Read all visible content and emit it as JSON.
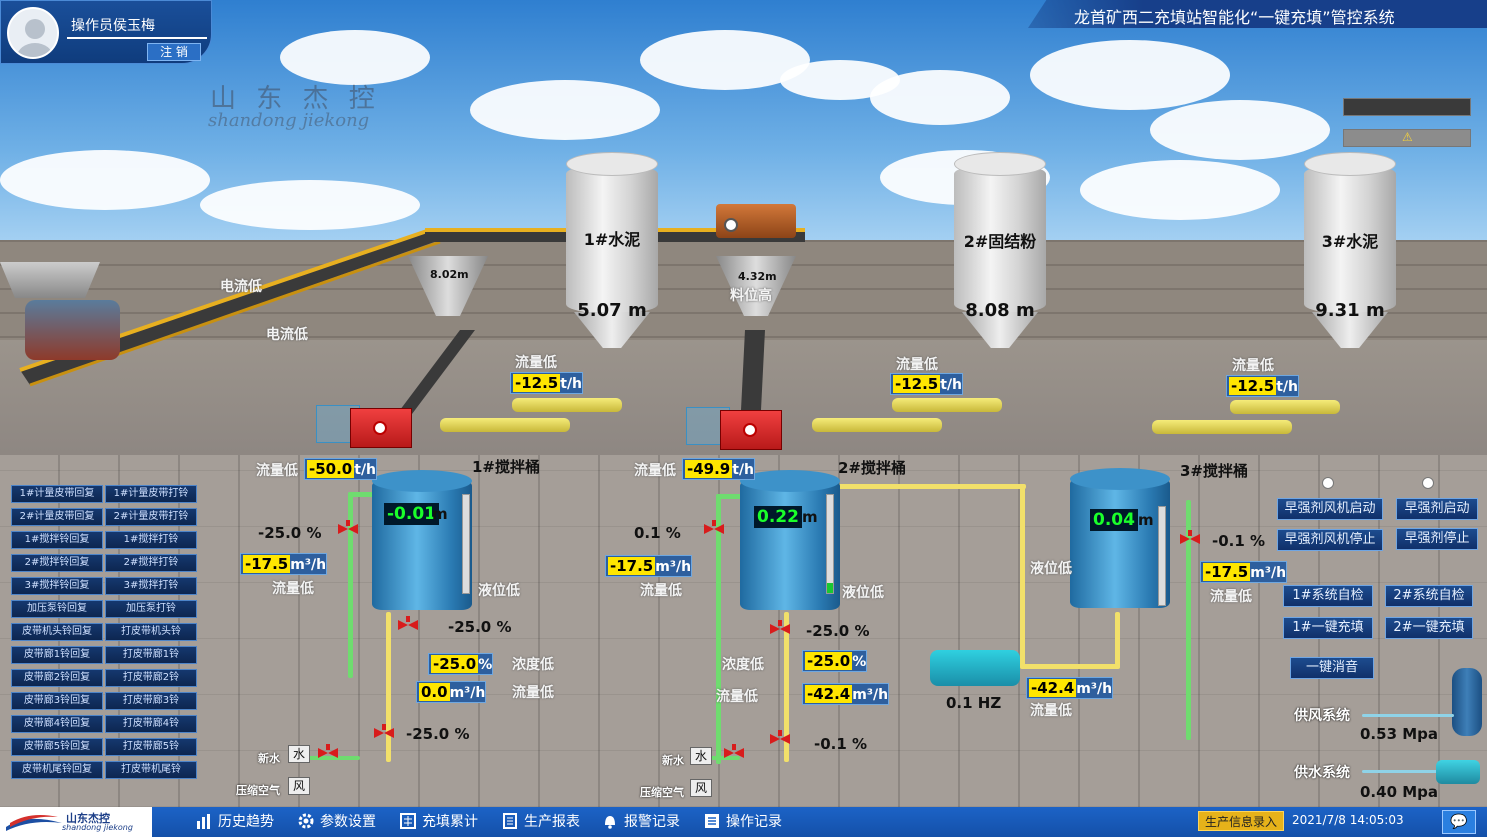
{
  "header": {
    "operator": "操作员侯玉梅",
    "logout": "注 销",
    "system_title": "龙首矿西二充填站智能化“一键充填”管控系统",
    "watermark_cn": "山 东 杰 控",
    "watermark_en": "shandong jiekong"
  },
  "silos": [
    {
      "name": "1#水泥",
      "level": "5.07 m"
    },
    {
      "name": "2#固结粉",
      "level": "8.08 m"
    },
    {
      "name": "3#水泥",
      "level": "9.31 m"
    }
  ],
  "hoppers": [
    {
      "value": "8.02m"
    },
    {
      "value": "4.32m"
    }
  ],
  "belt_status": {
    "s1": "电流低",
    "s2": "电流低",
    "hopper2": "料位高"
  },
  "silo_flows": [
    {
      "status": "流量低",
      "value": "-12.5",
      "unit": "t/h"
    },
    {
      "status": "流量低",
      "value": "-12.5",
      "unit": "t/h"
    },
    {
      "status": "流量低",
      "value": "-12.5",
      "unit": "t/h"
    }
  ],
  "tanks": [
    {
      "name": "1#搅拌桶",
      "level": "-0.01",
      "level_unit": "m",
      "level_status": "液位低",
      "feed_status": "流量低",
      "feed_value": "-50.0",
      "feed_unit": "t/h",
      "water_pct": "-25.0 %",
      "water_flow": "-17.5",
      "water_unit": "m³/h",
      "water_status": "流量低",
      "out_pct": "-25.0 %",
      "density": "-25.0",
      "density_unit": "%",
      "density_status": "浓度低",
      "out_flow": "0.0",
      "out_unit": "m³/h",
      "out_status": "流量低",
      "air_pct": "-25.0 %"
    },
    {
      "name": "2#搅拌桶",
      "level": "0.22",
      "level_unit": "m",
      "level_status": "液位低",
      "feed_status": "流量低",
      "feed_value": "-49.9",
      "feed_unit": "t/h",
      "water_pct": "0.1   %",
      "water_flow": "-17.5",
      "water_unit": "m³/h",
      "water_status": "流量低",
      "out_pct": "-25.0 %",
      "density": "-25.0",
      "density_unit": "%",
      "density_status": "浓度低",
      "out_flow": "-42.4",
      "out_unit": "m³/h",
      "out_status": "流量低",
      "air_pct": "-0.1  %"
    },
    {
      "name": "3#搅拌桶",
      "level": "0.04",
      "level_unit": "m",
      "level_status": "液位低",
      "water_pct": "-0.1  %",
      "water_flow": "-17.5",
      "water_unit": "m³/h",
      "water_status": "流量低"
    }
  ],
  "pump": {
    "hz": "0.1    HZ",
    "flow": "-42.4",
    "flow_unit": "m³/h",
    "flow_status": "流量低"
  },
  "water_air": {
    "water_label": "新水",
    "water_box": "水",
    "air_label": "压缩空气",
    "air_box": "风"
  },
  "left_buttons": [
    [
      "1#计量皮带回复",
      "1#计量皮带打铃"
    ],
    [
      "2#计量皮带回复",
      "2#计量皮带打铃"
    ],
    [
      "1#搅拌铃回复",
      "1#搅拌打铃"
    ],
    [
      "2#搅拌铃回复",
      "2#搅拌打铃"
    ],
    [
      "3#搅拌铃回复",
      "3#搅拌打铃"
    ],
    [
      "加压泵铃回复",
      "加压泵打铃"
    ],
    [
      "皮带机头铃回复",
      "打皮带机头铃"
    ],
    [
      "皮带廊1铃回复",
      "打皮带廊1铃"
    ],
    [
      "皮带廊2铃回复",
      "打皮带廊2铃"
    ],
    [
      "皮带廊3铃回复",
      "打皮带廊3铃"
    ],
    [
      "皮带廊4铃回复",
      "打皮带廊4铃"
    ],
    [
      "皮带廊5铃回复",
      "打皮带廊5铃"
    ],
    [
      "皮带机尾铃回复",
      "打皮带机尾铃"
    ]
  ],
  "right_buttons": {
    "r1": [
      "早强剂风机启动",
      "早强剂启动"
    ],
    "r2": [
      "早强剂风机停止",
      "早强剂停止"
    ],
    "r3": [
      "1#系统自检",
      "2#系统自检"
    ],
    "r4": [
      "1#一键充填",
      "2#一键充填"
    ],
    "silence": "一键消音"
  },
  "supply": {
    "air_label": "供风系统",
    "air_value": "0.53 Mpa",
    "water_label": "供水系统",
    "water_value": "0.40 Mpa"
  },
  "nav": [
    "历史趋势",
    "参数设置",
    "充填累计",
    "生产报表",
    "报警记录",
    "操作记录"
  ],
  "footer": {
    "prod_btn": "生产信息录入",
    "datetime": "2021/7/8 14:05:03",
    "logo_cn": "山东杰控",
    "logo_en": "shandong jiekong"
  },
  "colors": {
    "accent": "#1c63c7",
    "value_bg": "#ffe600",
    "level_green": "#1aff2a",
    "valve_red": "#d81c1c"
  }
}
